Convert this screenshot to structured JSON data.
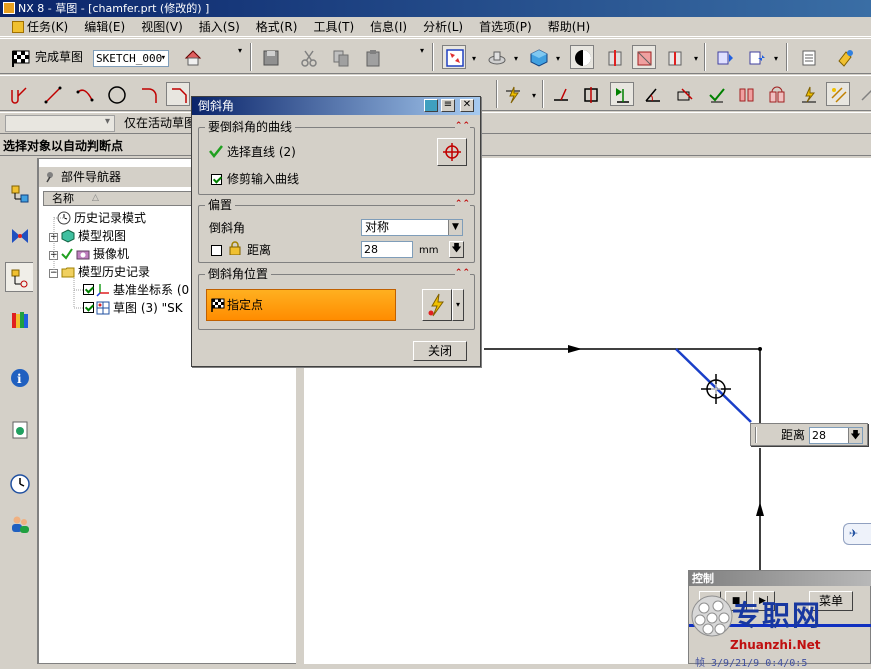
{
  "window": {
    "title": "NX 8 - 草图 - [chamfer.prt (修改的) ]"
  },
  "menu": {
    "items": [
      "任务(K)",
      "编辑(E)",
      "视图(V)",
      "插入(S)",
      "格式(R)",
      "工具(T)",
      "信息(I)",
      "分析(L)",
      "首选项(P)",
      "帮助(H)"
    ]
  },
  "toolbar1": {
    "finish_sketch": "完成草图",
    "sketch_name": "SKETCH_000"
  },
  "selection_bar": {
    "scope_label": "仅在活动草图"
  },
  "status": {
    "prompt": "选择对象以自动判断点"
  },
  "navigator": {
    "title": "部件导航器",
    "column_name": "名称",
    "rows": [
      {
        "label": "历史记录模式"
      },
      {
        "label": "模型视图"
      },
      {
        "label": "摄像机"
      },
      {
        "label": "模型历史记录"
      },
      {
        "label": "基准坐标系 (0"
      },
      {
        "label": "草图 (3) \"SK"
      }
    ]
  },
  "dialog": {
    "title": "倒斜角",
    "group_curves": "要倒斜角的曲线",
    "select_lines": "选择直线 (2)",
    "trim_input": "修剪输入曲线",
    "group_offset": "偏置",
    "chamfer_label": "倒斜角",
    "chamfer_mode": "对称",
    "distance_label": "距离",
    "distance_value": "28",
    "distance_unit": "mm",
    "group_position": "倒斜角位置",
    "specify_point": "指定点",
    "close_button": "关闭"
  },
  "canvas": {
    "tooltip_label": "距离",
    "tooltip_value": "28"
  },
  "control_panel": {
    "title": "控制",
    "menu_button": "菜单"
  },
  "watermark": {
    "text": "专职网",
    "url": "Zhuanzhi.Net",
    "status": "帧 3/9/21/9 0:4/0:5"
  },
  "colors": {
    "title_gradient_start": "#0a246a",
    "title_gradient_end": "#3a6ea5",
    "chamfer_line": "#1a3fc8",
    "specify_bar": "#ff9a10"
  }
}
